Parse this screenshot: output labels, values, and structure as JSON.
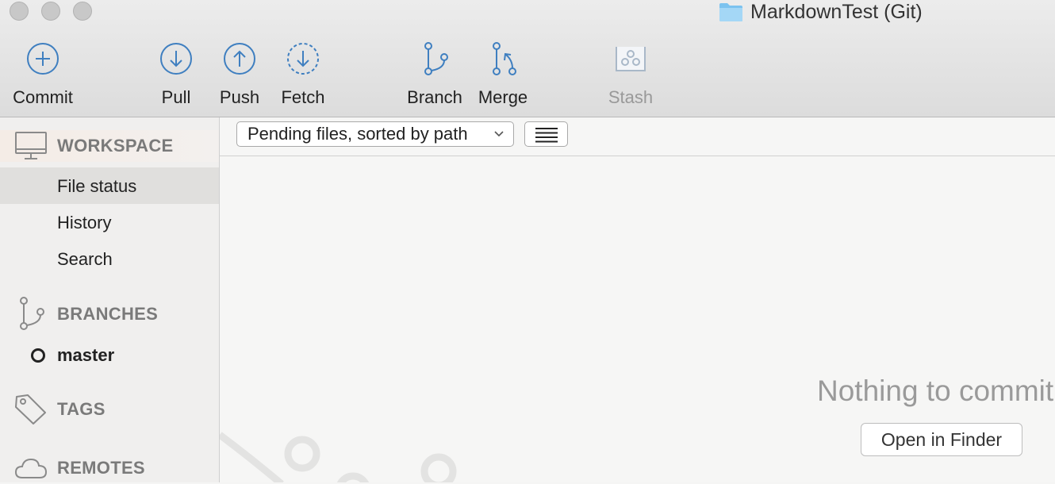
{
  "window": {
    "title": "MarkdownTest (Git)",
    "title_icon": "folder-icon"
  },
  "toolbar": {
    "buttons": [
      {
        "label": "Commit",
        "icon": "plus-circle-icon",
        "enabled": true
      },
      {
        "label": "Pull",
        "icon": "arrow-down-circle-icon",
        "enabled": true
      },
      {
        "label": "Push",
        "icon": "arrow-up-circle-icon",
        "enabled": true
      },
      {
        "label": "Fetch",
        "icon": "dashed-arrow-down-circle-icon",
        "enabled": true
      },
      {
        "label": "Branch",
        "icon": "branch-icon",
        "enabled": true
      },
      {
        "label": "Merge",
        "icon": "merge-icon",
        "enabled": true
      },
      {
        "label": "Stash",
        "icon": "stash-icon",
        "enabled": false
      }
    ],
    "accent_color": "#3f7fc0"
  },
  "sidebar": {
    "workspace": {
      "header": "WORKSPACE",
      "items": [
        "File status",
        "History",
        "Search"
      ],
      "selected": "File status"
    },
    "branches": {
      "header": "BRANCHES",
      "items": [
        "master"
      ],
      "current": "master"
    },
    "tags": {
      "header": "TAGS"
    },
    "remotes": {
      "header": "REMOTES"
    }
  },
  "main": {
    "filter_dropdown": "Pending files, sorted by path",
    "view_toggle_icon": "list-lines-icon",
    "empty_message": "Nothing to commit",
    "open_button": "Open in Finder"
  }
}
